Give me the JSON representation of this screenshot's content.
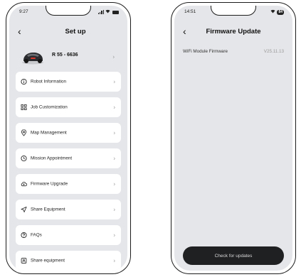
{
  "left_screen": {
    "status": {
      "time": "9:27"
    },
    "header": {
      "back_glyph": "‹",
      "title": "Set up"
    },
    "robot": {
      "name": "R 55 - 6636",
      "chevron": "›"
    },
    "menu": [
      {
        "label": "Robot Information",
        "icon": "info-icon"
      },
      {
        "label": "Job Customization",
        "icon": "grid-icon"
      },
      {
        "label": "Map Management",
        "icon": "location-pin-icon"
      },
      {
        "label": "Mission Appointment",
        "icon": "clock-icon"
      },
      {
        "label": "Firmware Upgrade",
        "icon": "cloud-upload-icon"
      },
      {
        "label": "Share Equipment",
        "icon": "send-icon"
      },
      {
        "label": "FAQs",
        "icon": "question-icon"
      },
      {
        "label": "Share equipment",
        "icon": "share-device-icon"
      }
    ],
    "chevron": "›"
  },
  "right_screen": {
    "status": {
      "time": "14:51",
      "battery": "84"
    },
    "header": {
      "back_glyph": "‹",
      "title": "Firmware Update"
    },
    "firmware": {
      "label": "WiFi Module Firmware",
      "version": "V25.11.13"
    },
    "button_label": "Check for updates"
  },
  "colors": {
    "screen_bg": "#e5e6e9",
    "card_bg": "#ffffff",
    "button_bg": "#1f2022",
    "frame": "#1c1c1c"
  }
}
